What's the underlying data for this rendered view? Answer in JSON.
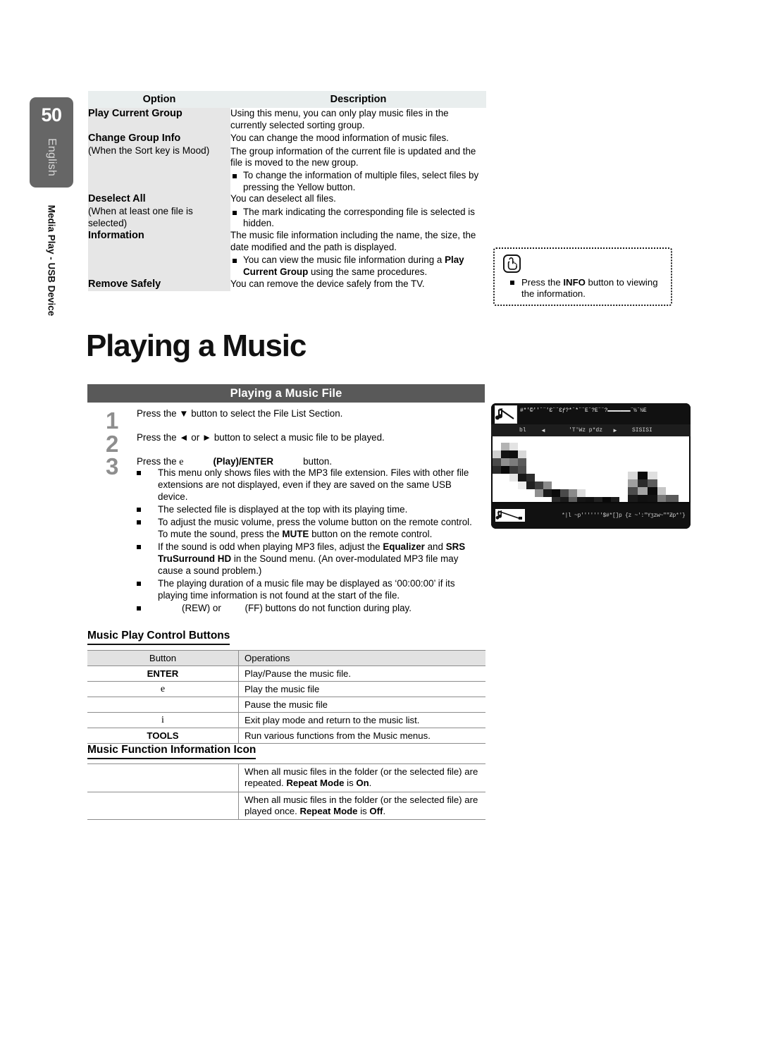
{
  "sidebar": {
    "page_number": "50",
    "language": "English",
    "section_label": "Media Play - USB Device"
  },
  "option_table": {
    "headers": [
      "Option",
      "Description"
    ],
    "rows": [
      {
        "option_title": "Play Current Group",
        "option_sub": "",
        "desc_paragraphs": [
          "Using this menu, you can only play music files in the currently selected sorting group."
        ],
        "desc_bullets": []
      },
      {
        "option_title": "Change Group Info",
        "option_sub": "(When the Sort key is Mood)",
        "desc_paragraphs": [
          "You can change the mood information of music files.",
          "The group information of the current file is updated and the file is moved to the new group."
        ],
        "desc_bullets": [
          "To change the information of multiple files, select files by pressing the Yellow button."
        ]
      },
      {
        "option_title": "Deselect All",
        "option_sub": "(When at least one file is selected)",
        "desc_paragraphs": [
          "You can deselect all files."
        ],
        "desc_bullets": [
          "The        mark indicating the corresponding file is selected is hidden."
        ]
      },
      {
        "option_title": "Information",
        "option_sub": "",
        "desc_paragraphs": [
          "The music file information including the name, the size, the date modified and the path is displayed."
        ],
        "desc_bullets": [
          "You can view the music file information during a Play Current Group using the same procedures."
        ]
      },
      {
        "option_title": "Remove Safely",
        "option_sub": "",
        "desc_paragraphs": [
          "You can remove the device safely from the TV."
        ],
        "desc_bullets": []
      }
    ]
  },
  "note_box": {
    "icon": "hand-press-icon",
    "text_before": "Press the ",
    "text_bold": "INFO",
    "text_after": " button to viewing the information."
  },
  "main_heading": "Playing a Music",
  "section_bar": "Playing a Music File",
  "steps": [
    {
      "number": "1",
      "text": "Press the ▼ button to select the File List Section."
    },
    {
      "number": "2",
      "text": "Press the ◄ or ► button to select a music file to be played."
    },
    {
      "number": "3",
      "text_a": "Press the ",
      "text_e": "e",
      "text_b": "(Play)/ENTER",
      "text_c": "button."
    }
  ],
  "bullets": [
    {
      "parts": [
        {
          "t": "This menu only shows files with the MP3 file extension. Files with other file extensions are not displayed, even if they are saved on the same USB device.",
          "b": false
        }
      ]
    },
    {
      "parts": [
        {
          "t": "The selected file is displayed at the top with its playing time.",
          "b": false
        }
      ]
    },
    {
      "parts": [
        {
          "t": "To adjust the music volume, press the volume button on the remote control. To mute the sound, press the ",
          "b": false
        },
        {
          "t": "MUTE",
          "b": true
        },
        {
          "t": " button on the remote control.",
          "b": false
        }
      ]
    },
    {
      "parts": [
        {
          "t": "If the sound is odd when playing MP3 files, adjust the ",
          "b": false
        },
        {
          "t": "Equalizer",
          "b": true
        },
        {
          "t": " and ",
          "b": false
        },
        {
          "t": "SRS TruSurround HD",
          "b": true
        },
        {
          "t": " in the Sound menu. (An over-modulated MP3 file may cause a sound problem.)",
          "b": false
        }
      ]
    },
    {
      "parts": [
        {
          "t": "The playing duration of a music file may be displayed as ‘00:00:00’ if its playing time information is not found at the start of the file.",
          "b": false
        }
      ]
    },
    {
      "parts": [
        {
          "t": "REW_GAP",
          "b": false
        },
        {
          "t": "(REW) or ",
          "b": false
        },
        {
          "t": "FF_GAP",
          "b": false
        },
        {
          "t": "(FF) buttons do not function during play.",
          "b": false
        }
      ]
    }
  ],
  "control_buttons": {
    "heading": "Music Play Control Buttons",
    "headers": [
      "Button",
      "Operations"
    ],
    "rows": [
      {
        "button": "ENTER",
        "style": "bold",
        "operation": "Play/Pause the music file."
      },
      {
        "button": "e",
        "style": "serif",
        "operation": "Play the music file"
      },
      {
        "button": "",
        "style": "",
        "operation": "Pause the music file"
      },
      {
        "button": "i",
        "style": "serif",
        "operation": "Exit play mode and return to the music list."
      },
      {
        "button": "TOOLS",
        "style": "bold",
        "operation": "Run various functions from the Music menus."
      }
    ]
  },
  "function_icon": {
    "heading": "Music Function Information Icon",
    "rows": [
      {
        "icon": "",
        "parts": [
          {
            "t": "When all music files in the folder (or the selected file) are repeated. ",
            "b": false
          },
          {
            "t": "Repeat Mode",
            "b": true
          },
          {
            "t": " is ",
            "b": false
          },
          {
            "t": "On",
            "b": true
          },
          {
            "t": ".",
            "b": false
          }
        ]
      },
      {
        "icon": "",
        "parts": [
          {
            "t": "When all music files in the folder (or the selected file) are played once. ",
            "b": false
          },
          {
            "t": "Repeat Mode",
            "b": true
          },
          {
            "t": " is ",
            "b": false
          },
          {
            "t": "Off",
            "b": true
          },
          {
            "t": ".",
            "b": false
          }
        ]
      }
    ]
  },
  "tv_screenshot": {
    "label": "tv-music-player-screenshot",
    "header_garbled": "#*'©''¨¨'Ɛ¨¨Ɛƒ?*¨*¨¨É¨?É¨¨?▬▬▬▬▬▬▬¨½¨½É",
    "toolbar_items": [
      "bl",
      "◄",
      "'T'Wz p*dz",
      "►",
      "SISISI"
    ],
    "footer_garbled": "*|l ~p'''''''$#*[]p {z ~':\"Yʒzw~\"\"Ƶp*'}"
  },
  "colors": {
    "sidebar_bg": "#666666",
    "table_header_bg": "#e9eeee",
    "option_cell_bg": "#e6e6e6",
    "section_bar_bg": "#595959",
    "step_number": "#8e8e8e",
    "mini_table_header_bg": "#e2e2e2"
  }
}
